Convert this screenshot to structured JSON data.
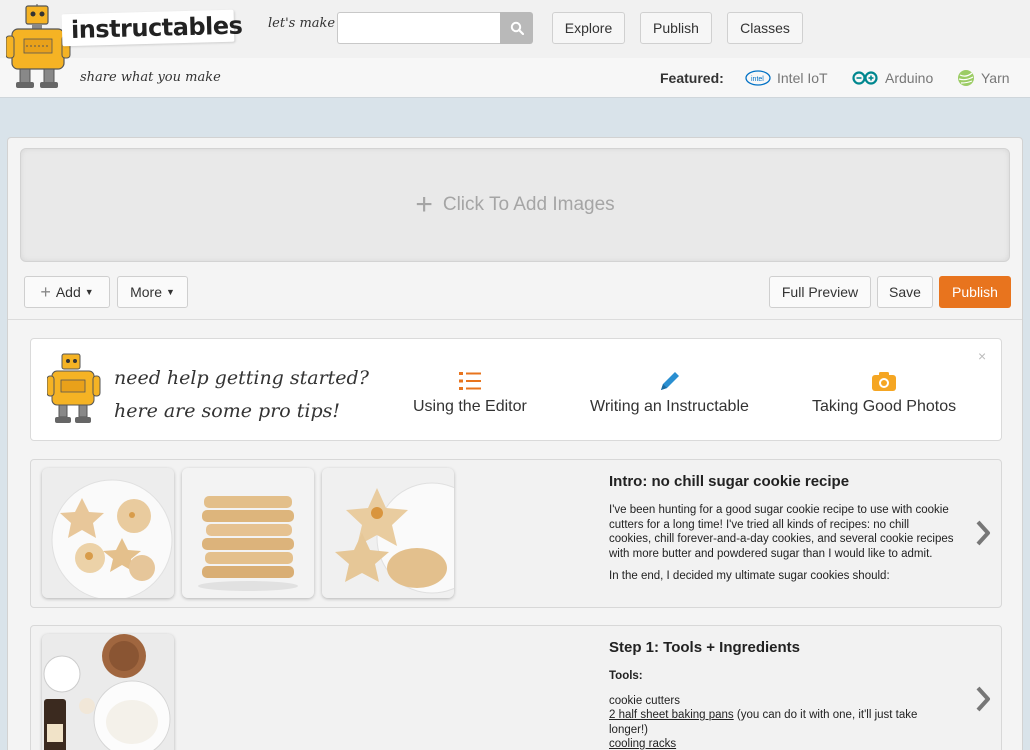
{
  "header": {
    "logo_text": "instructables",
    "tagline": "share what you make",
    "lets_make": "let's make",
    "search": {
      "value": "",
      "placeholder": ""
    },
    "nav": {
      "explore": "Explore",
      "publish": "Publish",
      "classes": "Classes"
    },
    "featured_label": "Featured:",
    "featured": [
      {
        "name": "Intel IoT",
        "icon": "intel-icon",
        "color": "#0071c5"
      },
      {
        "name": "Arduino",
        "icon": "arduino-icon",
        "color": "#00878f"
      },
      {
        "name": "Yarn",
        "icon": "yarn-icon",
        "color": "#8bc34a"
      }
    ]
  },
  "editor": {
    "add_images": "Click To Add Images",
    "toolbar": {
      "add": "Add",
      "more": "More",
      "full_preview": "Full Preview",
      "save": "Save",
      "publish": "Publish"
    }
  },
  "tips": {
    "line1": "need help getting started?",
    "line2": "here are some pro tips!",
    "items": [
      {
        "label": "Using the Editor",
        "icon": "list-icon"
      },
      {
        "label": "Writing an Instructable",
        "icon": "pencil-icon"
      },
      {
        "label": "Taking Good Photos",
        "icon": "camera-icon"
      }
    ],
    "close": "×"
  },
  "steps": [
    {
      "title": "Intro: no chill sugar cookie recipe",
      "para1": "I've been hunting for a good sugar cookie recipe to use with cookie cutters for a long time! I've tried all kinds of recipes: no chill cookies, chill forever-and-a-day cookies, and several cookie recipes with more butter and powdered sugar than I would like to admit.",
      "para2": "In the end, I decided my ultimate sugar cookies should:"
    },
    {
      "title": "Step 1: Tools + Ingredients",
      "tools_label": "Tools:",
      "item1": "cookie cutters",
      "item2_link": "2 half sheet baking pans",
      "item2_rest": " (you can do it with one, it'll just take longer!)",
      "item3_link": "cooling racks"
    }
  ],
  "colors": {
    "accent": "#e8741e",
    "background": "#d9e3ea",
    "robot": "#f5b324"
  }
}
